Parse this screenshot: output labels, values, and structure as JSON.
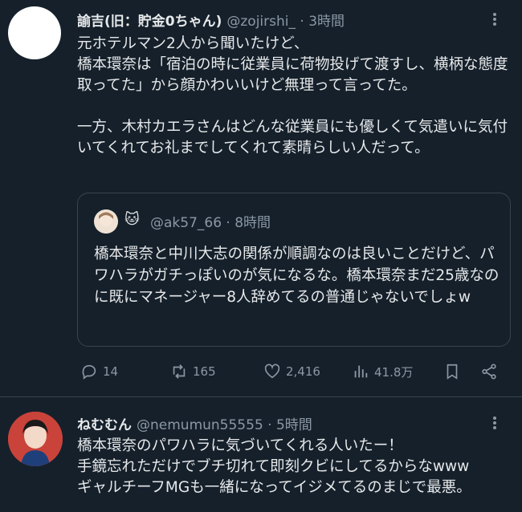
{
  "tweet1": {
    "name": "諭吉(旧：貯金0ちゃん)",
    "handle_time": "@zojirshi_ · 3時間",
    "text": "元ホテルマン2人から聞いたけど、\n橋本環奈は「宿泊の時に従業員に荷物投げて渡すし、横柄な態度取ってた」から顔かわいいけど無理って言ってた。\n\n一方、木村カエラさんはどんな従業員にも優しくて気遣いに気付いてくれてお礼までしてくれて素晴らしい人だって。",
    "quote": {
      "emoji": "🐱",
      "handle_time": "@ak57_66 · 8時間",
      "text": "橋本環奈と中川大志の関係が順調なのは良いことだけど、パワハラがガチっぽいのが気になるな。橋本環奈まだ25歳なのに既にマネージャー8人辞めてるの普通じゃないでしょw"
    },
    "actions": {
      "replies": "14",
      "retweets": "165",
      "likes": "2,416",
      "views": "41.8万"
    }
  },
  "tweet2": {
    "name": "ねむむん",
    "handle_time": "@nemumun55555 · 5時間",
    "text": "橋本環奈のパワハラに気づいてくれる人いたー！\n手鏡忘れただけでブチ切れて即刻クビにしてるからなwww\nギャルチーフMGも一緒になってイジメてるのまじで最悪。"
  },
  "colors": {
    "background": "#15202b",
    "text": "#e7e9ea",
    "muted": "#8b98a5",
    "border": "#38444d"
  }
}
